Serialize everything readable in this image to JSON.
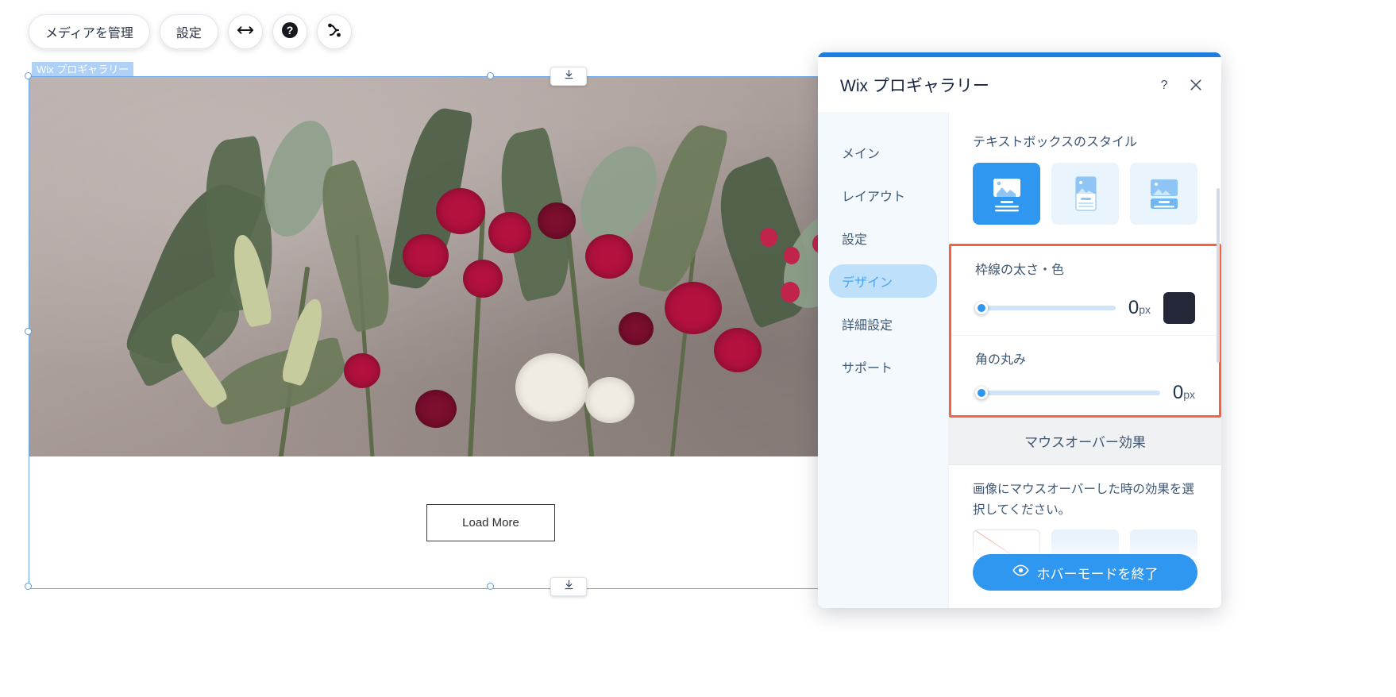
{
  "toolbar": {
    "manage_media_label": "メディアを管理",
    "settings_label": "設定",
    "stretch_icon": "arrows-horizontal-icon",
    "help_icon": "question-mark-circle-icon",
    "animation_icon": "motion-path-icon"
  },
  "canvas": {
    "component_label": "Wix プロギャラリー",
    "load_more_label": "Load More",
    "top_drag_icon": "download-arrow-icon",
    "bottom_drag_icon": "download-arrow-icon"
  },
  "panel": {
    "title": "Wix プロギャラリー",
    "help_icon": "question-mark-icon",
    "close_icon": "close-x-icon",
    "accent_color": "#1c7ee0",
    "nav": [
      {
        "label": "メイン",
        "active": false
      },
      {
        "label": "レイアウト",
        "active": false
      },
      {
        "label": "設定",
        "active": false
      },
      {
        "label": "デザイン",
        "active": true
      },
      {
        "label": "詳細設定",
        "active": false
      },
      {
        "label": "サポート",
        "active": false
      }
    ],
    "textbox_style": {
      "title": "テキストボックスのスタイル",
      "options": [
        {
          "name": "style-image-over-text",
          "selected": true
        },
        {
          "name": "style-text-below-image",
          "selected": false
        },
        {
          "name": "style-text-overlay-bottom",
          "selected": false
        }
      ]
    },
    "border": {
      "label": "枠線の太さ・色",
      "value": "0",
      "unit": "px",
      "slider_percent": 0,
      "color": "#242738"
    },
    "corner_radius": {
      "label": "角の丸み",
      "value": "0",
      "unit": "px",
      "slider_percent": 0
    },
    "hover": {
      "section_label": "マウスオーバー効果",
      "description": "画像にマウスオーバーした時の効果を選択してください。"
    },
    "cta": {
      "label": "ホバーモードを終了",
      "icon": "eye-icon"
    },
    "highlight_color": "#f4623f"
  }
}
